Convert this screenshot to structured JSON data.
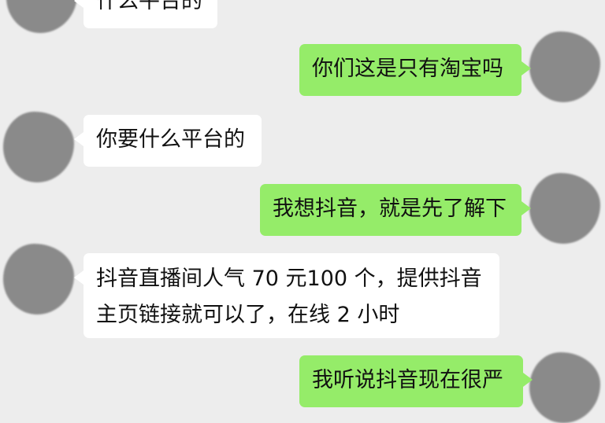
{
  "messages": [
    {
      "side": "left",
      "text": "什么平台的"
    },
    {
      "side": "right",
      "text": "你们这是只有淘宝吗"
    },
    {
      "side": "left",
      "text": "你要什么平台的"
    },
    {
      "side": "right",
      "text": "我想抖音，就是先了解下"
    },
    {
      "side": "left",
      "lines": [
        "抖音直播间人气 70 元100 个，提供抖音",
        "主页链接就可以了，在线 2 小时"
      ]
    },
    {
      "side": "right",
      "text": "我听说抖音现在很严"
    }
  ]
}
